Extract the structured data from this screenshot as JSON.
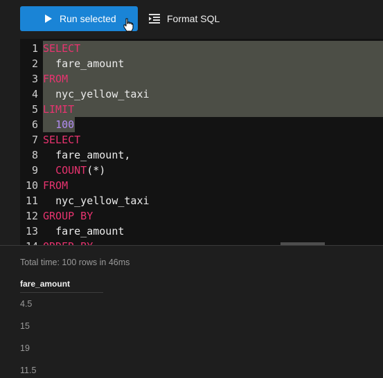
{
  "toolbar": {
    "run_label": "Run selected",
    "format_label": "Format SQL",
    "run_color": "#1a84d6"
  },
  "editor": {
    "lines": [
      {
        "n": "1",
        "tokens": [
          {
            "t": "SELECT",
            "c": "kw"
          }
        ]
      },
      {
        "n": "2",
        "tokens": [
          {
            "t": "  ",
            "c": "id"
          },
          {
            "t": "fare_amount",
            "c": "id"
          }
        ]
      },
      {
        "n": "3",
        "tokens": [
          {
            "t": "FROM",
            "c": "kw"
          }
        ]
      },
      {
        "n": "4",
        "tokens": [
          {
            "t": "  ",
            "c": "id"
          },
          {
            "t": "nyc_yellow_taxi",
            "c": "id"
          }
        ]
      },
      {
        "n": "5",
        "tokens": [
          {
            "t": "LIMIT",
            "c": "kw"
          }
        ]
      },
      {
        "n": "6",
        "tokens": [
          {
            "t": "  ",
            "c": "id"
          },
          {
            "t": "100",
            "c": "num"
          }
        ]
      },
      {
        "n": "7",
        "tokens": [
          {
            "t": "SELECT",
            "c": "kw"
          }
        ]
      },
      {
        "n": "8",
        "tokens": [
          {
            "t": "  ",
            "c": "id"
          },
          {
            "t": "fare_amount,",
            "c": "id"
          }
        ]
      },
      {
        "n": "9",
        "tokens": [
          {
            "t": "  ",
            "c": "id"
          },
          {
            "t": "COUNT",
            "c": "fn"
          },
          {
            "t": "(*)",
            "c": "punc"
          }
        ]
      },
      {
        "n": "10",
        "tokens": [
          {
            "t": "FROM",
            "c": "kw"
          }
        ]
      },
      {
        "n": "11",
        "tokens": [
          {
            "t": "  ",
            "c": "id"
          },
          {
            "t": "nyc_yellow_taxi",
            "c": "id"
          }
        ]
      },
      {
        "n": "12",
        "tokens": [
          {
            "t": "GROUP BY",
            "c": "kw"
          }
        ]
      },
      {
        "n": "13",
        "tokens": [
          {
            "t": "  ",
            "c": "id"
          },
          {
            "t": "fare_amount",
            "c": "id"
          }
        ]
      },
      {
        "n": "14",
        "tokens": [
          {
            "t": "ORDER BY",
            "c": "kw"
          }
        ]
      }
    ],
    "selected_lines": 6
  },
  "results": {
    "summary": "Total time: 100 rows in 46ms",
    "column": "fare_amount",
    "rows": [
      "4.5",
      "15",
      "19",
      "11.5"
    ]
  }
}
